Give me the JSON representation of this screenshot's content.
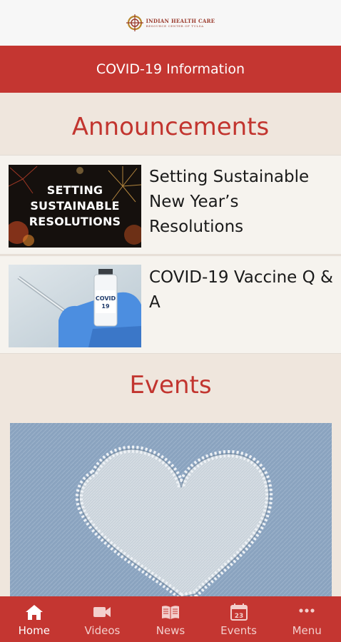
{
  "header": {
    "logo_main": "INDIAN HEALTH CARE",
    "logo_sub": "RESOURCE CENTER OF TULSA"
  },
  "covid_banner": {
    "label": "COVID-19 Information"
  },
  "announcements": {
    "title": "Announcements",
    "items": [
      {
        "title": "Setting Sustainable New Year’s Resolutions",
        "thumb_caption": "SETTING\nSUSTAINABLE\nRESOLUTIONS"
      },
      {
        "title": " COVID-19 Vaccine Q & A",
        "vial_label": "COVID\n19"
      }
    ]
  },
  "events": {
    "title": "Events"
  },
  "tabbar": {
    "tabs": [
      {
        "label": "Home",
        "icon": "home-icon",
        "active": true
      },
      {
        "label": "Videos",
        "icon": "video-camera-icon",
        "active": false
      },
      {
        "label": "News",
        "icon": "newspaper-icon",
        "active": false
      },
      {
        "label": "Events",
        "icon": "calendar-icon",
        "active": false,
        "calendar_day": "23"
      },
      {
        "label": "Menu",
        "icon": "more-dots-icon",
        "active": false
      }
    ]
  },
  "colors": {
    "brand_red": "#c43631",
    "title_red": "#c2352f",
    "page_bg": "#efe6dd"
  }
}
